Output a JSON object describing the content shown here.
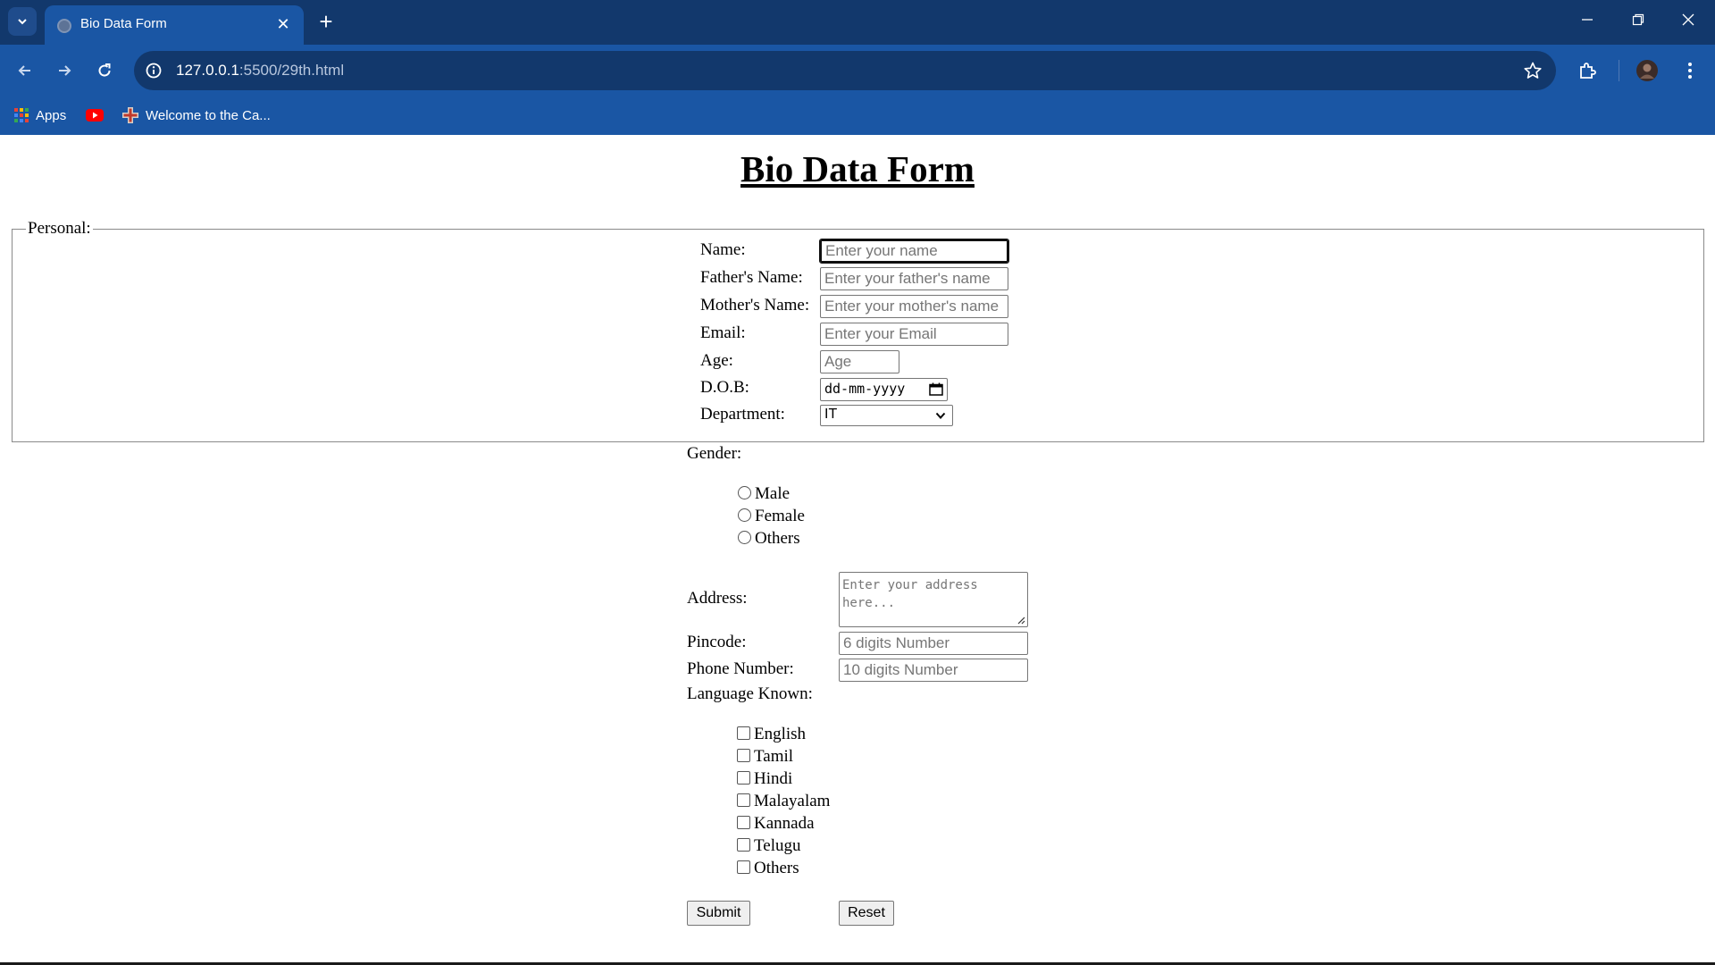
{
  "browser": {
    "tab_title": "Bio Data Form",
    "url_host": "127.0.0.1",
    "url_path": ":5500/29th.html",
    "bookmarks": [
      "Apps",
      "Welcome to the Ca..."
    ]
  },
  "page": {
    "title": "Bio Data Form",
    "legend": "Personal:",
    "personal_fields": [
      {
        "label": "Name:",
        "placeholder": "Enter your name"
      },
      {
        "label": "Father's Name:",
        "placeholder": "Enter your father's name"
      },
      {
        "label": "Mother's Name:",
        "placeholder": "Enter your mother's name"
      },
      {
        "label": "Email:",
        "placeholder": "Enter your Email"
      },
      {
        "label": "Age:",
        "placeholder": "Age"
      }
    ],
    "dob": {
      "label": "D.O.B:",
      "value": "dd-mm-yyyy"
    },
    "department": {
      "label": "Department:",
      "selected": "IT"
    },
    "gender": {
      "label": "Gender:",
      "options": [
        "Male",
        "Female",
        "Others"
      ]
    },
    "address": {
      "label": "Address:",
      "placeholder": "Enter your address here..."
    },
    "pincode": {
      "label": "Pincode:",
      "placeholder": "6 digits Number"
    },
    "phone": {
      "label": "Phone Number:",
      "placeholder": "10 digits Number"
    },
    "languages": {
      "label": "Language Known:",
      "options": [
        "English",
        "Tamil",
        "Hindi",
        "Malayalam",
        "Kannada",
        "Telugu",
        "Others"
      ]
    },
    "submit_label": "Submit",
    "reset_label": "Reset"
  }
}
